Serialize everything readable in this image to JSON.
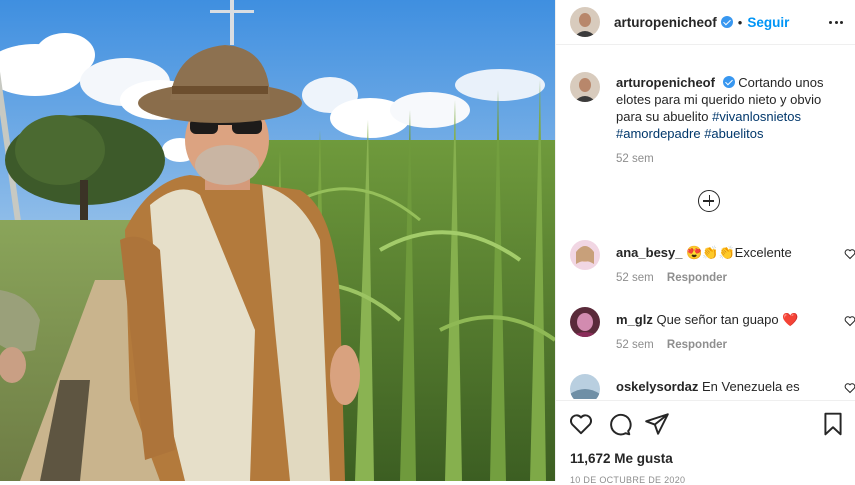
{
  "post": {
    "author": {
      "username": "arturopenicheof",
      "verified": true,
      "follow_label": "Seguir"
    },
    "caption": {
      "username": "arturopenicheof",
      "text": "Cortando unos elotes para mi querido nieto y obvio para su abuelito",
      "hashtags": [
        "#vivanlosnietos",
        "#amordepadre",
        "#abuelitos"
      ],
      "time": "52 sem"
    },
    "comments": [
      {
        "username": "ana_besy_",
        "text": "😍👏👏Excelente",
        "time": "52 sem",
        "reply_label": "Responder"
      },
      {
        "username": "m_glz",
        "text": "Que señor tan guapo ❤️",
        "time": "52 sem",
        "reply_label": "Responder"
      },
      {
        "username": "oskelysordaz",
        "text": "En Venezuela es"
      }
    ],
    "likes": "11,672 Me gusta",
    "date": "10 de octubre de 2020"
  },
  "icons": [
    "verified-icon",
    "more-options-icon",
    "load-more-comments-icon",
    "heart-icon",
    "comment-icon",
    "share-icon",
    "bookmark-icon"
  ],
  "colors": {
    "accent": "#0095f6",
    "verified": "#3897f0",
    "hashtag": "#00376b",
    "text": "#262626",
    "muted": "#8e8e8e",
    "like_red": "#ed4956"
  }
}
